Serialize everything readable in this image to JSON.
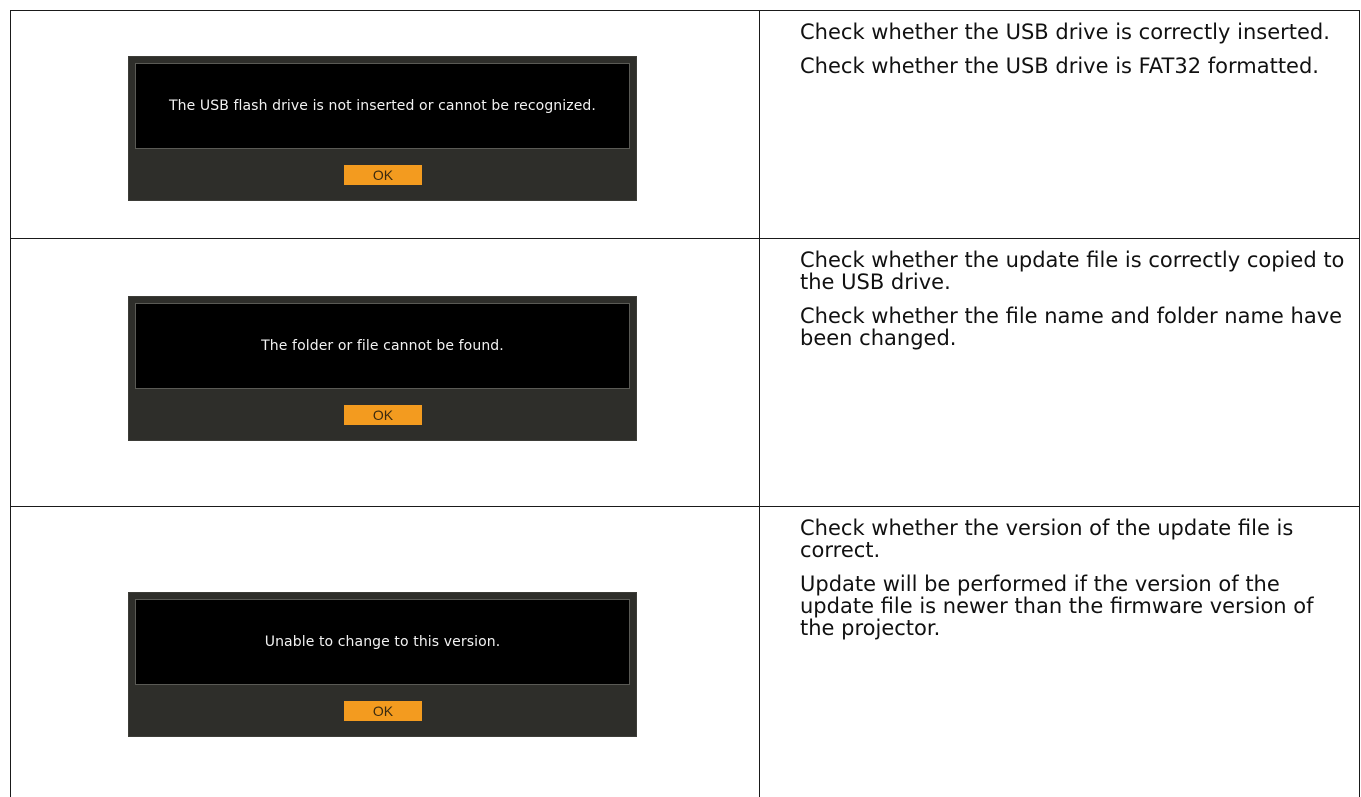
{
  "rows": [
    {
      "dialog": {
        "message": "The USB flash drive is not inserted or cannot be recognized.",
        "ok_label": "OK"
      },
      "notes": [
        "Check whether the USB drive is correctly inserted.",
        "Check whether the USB drive is FAT32 formatted."
      ]
    },
    {
      "dialog": {
        "message": "The folder or file cannot be found.",
        "ok_label": "OK"
      },
      "notes": [
        "Check whether the update file is correctly copied to the USB drive.",
        "Check whether the file name and folder name have been changed."
      ]
    },
    {
      "dialog": {
        "message": "Unable to change to this version.",
        "ok_label": "OK"
      },
      "notes": [
        "Check whether the version of the update file is correct.",
        "Update will be performed if the version of the update file is newer than the firmware version of the projector."
      ]
    }
  ]
}
